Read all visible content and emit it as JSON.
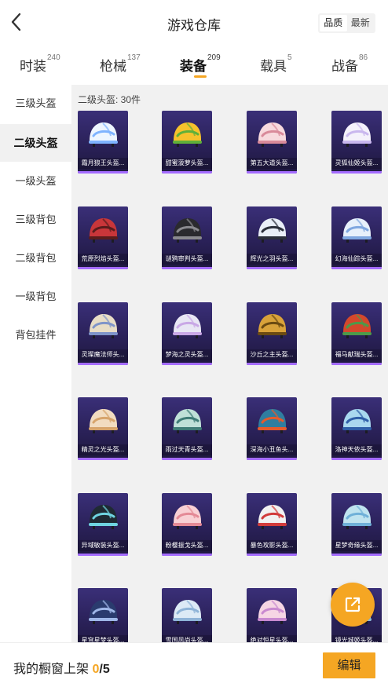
{
  "header": {
    "title": "游戏仓库",
    "back_icon": "chevron-left-icon",
    "sort": [
      "品质",
      "最新"
    ],
    "sort_active": "品质"
  },
  "tabs": [
    {
      "label": "时装",
      "count": "240"
    },
    {
      "label": "枪械",
      "count": "137"
    },
    {
      "label": "装备",
      "count": "209",
      "active": true
    },
    {
      "label": "载具",
      "count": "5"
    },
    {
      "label": "战备",
      "count": "86"
    }
  ],
  "sidebar": {
    "items": [
      "三级头盔",
      "二级头盔",
      "一级头盔",
      "三级背包",
      "二级背包",
      "一级背包",
      "背包挂件"
    ],
    "active": "二级头盔"
  },
  "content": {
    "count_text": "二级头盔: 30件",
    "items": [
      {
        "name": "霜月狼王头盔...",
        "colors": [
          "#eef6ff",
          "#7fb4ff"
        ]
      },
      {
        "name": "甜蜜菠萝头盔...",
        "colors": [
          "#f6c22c",
          "#5fb03a"
        ]
      },
      {
        "name": "第五大道头盔...",
        "colors": [
          "#f7d9dd",
          "#d98a9a"
        ]
      },
      {
        "name": "灵狐仙姬头盔...",
        "colors": [
          "#f4f1fb",
          "#c9b7ee"
        ]
      },
      {
        "name": "荒原烈焰头盔...",
        "colors": [
          "#c8363a",
          "#5a1c1c"
        ]
      },
      {
        "name": "谜鸦审判头盔...",
        "colors": [
          "#2a2a2e",
          "#8a8a8f"
        ]
      },
      {
        "name": "辉光之羽头盔...",
        "colors": [
          "#e9eef7",
          "#2b2f3a"
        ]
      },
      {
        "name": "幻海仙踪头盔...",
        "colors": [
          "#e7f0fb",
          "#7fa7e0"
        ]
      },
      {
        "name": "灵璨魔法师头...",
        "colors": [
          "#e8ddc6",
          "#7f94c9"
        ]
      },
      {
        "name": "梦海之灵头盔...",
        "colors": [
          "#e8e6f4",
          "#c9a8e6"
        ]
      },
      {
        "name": "沙丘之主头盔...",
        "colors": [
          "#d9a23a",
          "#6b4a12"
        ]
      },
      {
        "name": "福马献瑞头盔...",
        "colors": [
          "#d4482c",
          "#4c9a4a"
        ]
      },
      {
        "name": "精灵之光头盔...",
        "colors": [
          "#f2dcc0",
          "#d7a46b"
        ]
      },
      {
        "name": "雨过天青头盔...",
        "colors": [
          "#bfe0d8",
          "#3f7c77"
        ]
      },
      {
        "name": "深海小丑鱼头...",
        "colors": [
          "#2f7ea0",
          "#e55b2c"
        ]
      },
      {
        "name": "洛神天依头盔...",
        "colors": [
          "#a9d8ef",
          "#2f5fa8"
        ]
      },
      {
        "name": "异域敏装头盔...",
        "colors": [
          "#1f2a33",
          "#6fd3e0"
        ]
      },
      {
        "name": "粉樱振戈头盔...",
        "colors": [
          "#f8d0d4",
          "#e48a96"
        ]
      },
      {
        "name": "暴色攻影头盔...",
        "colors": [
          "#f1f1f1",
          "#d23c3c"
        ]
      },
      {
        "name": "星梦奇缘头盔...",
        "colors": [
          "#bfe3ef",
          "#6fb0d8"
        ]
      },
      {
        "name": "星穹星梦头盔...",
        "colors": [
          "#2a3b6e",
          "#9fb7e8"
        ]
      },
      {
        "name": "雪国风尚头盔...",
        "colors": [
          "#dceaf6",
          "#8fb4d8"
        ]
      },
      {
        "name": "绝对恒星头盔...",
        "colors": [
          "#f6d6e4",
          "#c98ad0"
        ]
      },
      {
        "name": "镜光城姬头盔...",
        "colors": [
          "#eaf4fb",
          "#98c8e6"
        ]
      }
    ]
  },
  "fab": {
    "icon": "open-external-icon"
  },
  "bottom": {
    "showcase_label": "我的橱窗上架",
    "current": "0",
    "separator_max": "/5",
    "edit_label": "编辑"
  },
  "accent_color": "#f5a623"
}
